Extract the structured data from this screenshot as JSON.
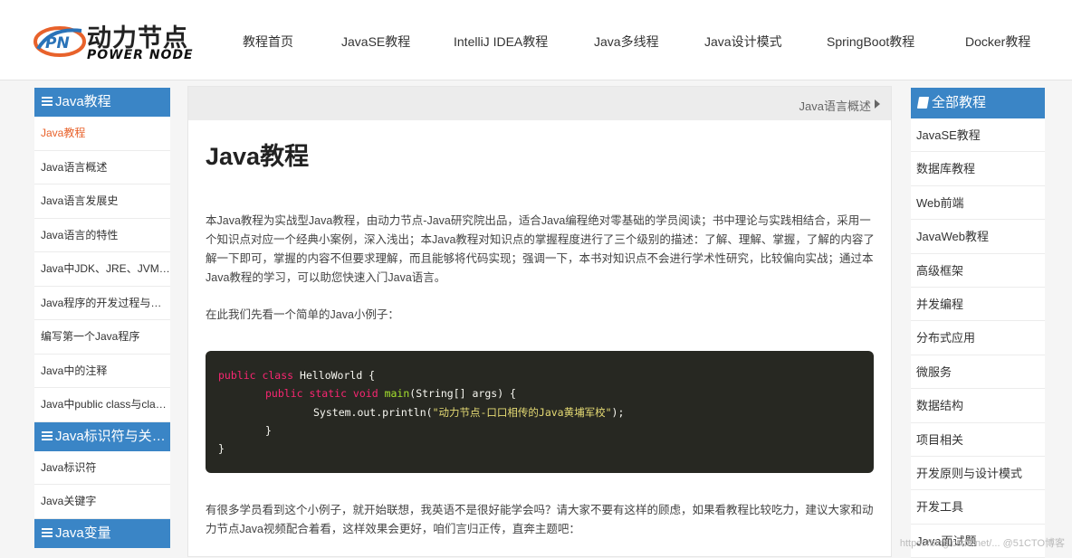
{
  "logo": {
    "badge": "PN",
    "cn": "动力节点",
    "en": "POWER NODE"
  },
  "nav": [
    "教程首页",
    "JavaSE教程",
    "IntelliJ IDEA教程",
    "Java多线程",
    "Java设计模式",
    "SpringBoot教程",
    "Docker教程"
  ],
  "left": {
    "sections": [
      {
        "title": "Java教程",
        "items": [
          "Java教程",
          "Java语言概述",
          "Java语言发展史",
          "Java语言的特性",
          "Java中JDK、JRE、JVM的关系",
          "Java程序的开发过程与运行原理",
          "编写第一个Java程序",
          "Java中的注释",
          "Java中public class与class的区别"
        ]
      },
      {
        "title": "Java标识符与关键字",
        "items": [
          "Java标识符",
          "Java关键字"
        ]
      },
      {
        "title": "Java变量",
        "items": []
      }
    ],
    "active_index": 0
  },
  "main": {
    "breadcrumb": "Java语言概述",
    "title": "Java教程",
    "intro": "本Java教程为实战型Java教程，由动力节点-Java研究院出品，适合Java编程绝对零基础的学员阅读；书中理论与实践相结合，采用一个知识点对应一个经典小案例，深入浅出；本Java教程对知识点的掌握程度进行了三个级别的描述：了解、理解、掌握，了解的内容了解一下即可，掌握的内容不但要求理解，而且能够将代码实现；强调一下，本书对知识点不会进行学术性研究，比较偏向实战；通过本Java教程的学习，可以助您快速入门Java语言。",
    "example_intro": "在此我们先看一个简单的Java小例子：",
    "code": {
      "l1_kw": "public class",
      "l1_rest": " HelloWorld {",
      "l2_kw": "public static void",
      "l2_fn": "main",
      "l2_rest": "(String[] args) {",
      "l3_pre": "System.out.println(",
      "l3_str": "\"动力节点-口口相传的Java黄埔军校\"",
      "l3_post": ");",
      "l4": "}",
      "l5": "}"
    },
    "outro": "有很多学员看到这个小例子，就开始联想，我英语不是很好能学会吗？请大家不要有这样的顾虑，如果看教程比较吃力，建议大家和动力节点Java视频配合着看，这样效果会更好，咱们言归正传，直奔主题吧："
  },
  "right": {
    "title": "全部教程",
    "items": [
      "JavaSE教程",
      "数据库教程",
      "Web前端",
      "JavaWeb教程",
      "高级框架",
      "并发编程",
      "分布式应用",
      "微服务",
      "数据结构",
      "项目相关",
      "开发原则与设计模式",
      "开发工具",
      "Java面试题"
    ]
  },
  "watermark": "https://blog.csdn.net/...  @51CTO博客",
  "colors": {
    "accent": "#3a85c6",
    "active": "#e8622b",
    "code_bg": "#272822"
  }
}
